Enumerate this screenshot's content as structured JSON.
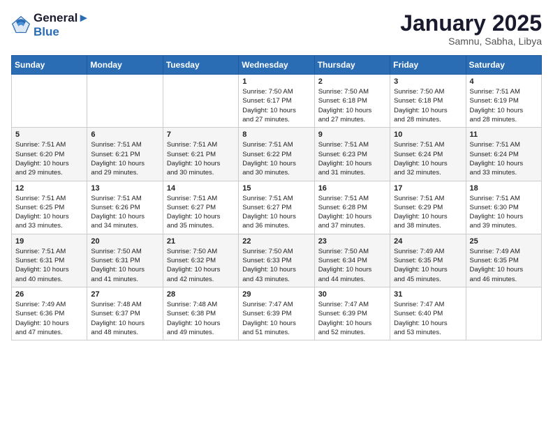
{
  "logo": {
    "line1": "General",
    "line2": "Blue"
  },
  "title": "January 2025",
  "subtitle": "Samnu, Sabha, Libya",
  "days_of_week": [
    "Sunday",
    "Monday",
    "Tuesday",
    "Wednesday",
    "Thursday",
    "Friday",
    "Saturday"
  ],
  "weeks": [
    [
      {
        "day": "",
        "content": ""
      },
      {
        "day": "",
        "content": ""
      },
      {
        "day": "",
        "content": ""
      },
      {
        "day": "1",
        "content": "Sunrise: 7:50 AM\nSunset: 6:17 PM\nDaylight: 10 hours\nand 27 minutes."
      },
      {
        "day": "2",
        "content": "Sunrise: 7:50 AM\nSunset: 6:18 PM\nDaylight: 10 hours\nand 27 minutes."
      },
      {
        "day": "3",
        "content": "Sunrise: 7:50 AM\nSunset: 6:18 PM\nDaylight: 10 hours\nand 28 minutes."
      },
      {
        "day": "4",
        "content": "Sunrise: 7:51 AM\nSunset: 6:19 PM\nDaylight: 10 hours\nand 28 minutes."
      }
    ],
    [
      {
        "day": "5",
        "content": "Sunrise: 7:51 AM\nSunset: 6:20 PM\nDaylight: 10 hours\nand 29 minutes."
      },
      {
        "day": "6",
        "content": "Sunrise: 7:51 AM\nSunset: 6:21 PM\nDaylight: 10 hours\nand 29 minutes."
      },
      {
        "day": "7",
        "content": "Sunrise: 7:51 AM\nSunset: 6:21 PM\nDaylight: 10 hours\nand 30 minutes."
      },
      {
        "day": "8",
        "content": "Sunrise: 7:51 AM\nSunset: 6:22 PM\nDaylight: 10 hours\nand 30 minutes."
      },
      {
        "day": "9",
        "content": "Sunrise: 7:51 AM\nSunset: 6:23 PM\nDaylight: 10 hours\nand 31 minutes."
      },
      {
        "day": "10",
        "content": "Sunrise: 7:51 AM\nSunset: 6:24 PM\nDaylight: 10 hours\nand 32 minutes."
      },
      {
        "day": "11",
        "content": "Sunrise: 7:51 AM\nSunset: 6:24 PM\nDaylight: 10 hours\nand 33 minutes."
      }
    ],
    [
      {
        "day": "12",
        "content": "Sunrise: 7:51 AM\nSunset: 6:25 PM\nDaylight: 10 hours\nand 33 minutes."
      },
      {
        "day": "13",
        "content": "Sunrise: 7:51 AM\nSunset: 6:26 PM\nDaylight: 10 hours\nand 34 minutes."
      },
      {
        "day": "14",
        "content": "Sunrise: 7:51 AM\nSunset: 6:27 PM\nDaylight: 10 hours\nand 35 minutes."
      },
      {
        "day": "15",
        "content": "Sunrise: 7:51 AM\nSunset: 6:27 PM\nDaylight: 10 hours\nand 36 minutes."
      },
      {
        "day": "16",
        "content": "Sunrise: 7:51 AM\nSunset: 6:28 PM\nDaylight: 10 hours\nand 37 minutes."
      },
      {
        "day": "17",
        "content": "Sunrise: 7:51 AM\nSunset: 6:29 PM\nDaylight: 10 hours\nand 38 minutes."
      },
      {
        "day": "18",
        "content": "Sunrise: 7:51 AM\nSunset: 6:30 PM\nDaylight: 10 hours\nand 39 minutes."
      }
    ],
    [
      {
        "day": "19",
        "content": "Sunrise: 7:51 AM\nSunset: 6:31 PM\nDaylight: 10 hours\nand 40 minutes."
      },
      {
        "day": "20",
        "content": "Sunrise: 7:50 AM\nSunset: 6:31 PM\nDaylight: 10 hours\nand 41 minutes."
      },
      {
        "day": "21",
        "content": "Sunrise: 7:50 AM\nSunset: 6:32 PM\nDaylight: 10 hours\nand 42 minutes."
      },
      {
        "day": "22",
        "content": "Sunrise: 7:50 AM\nSunset: 6:33 PM\nDaylight: 10 hours\nand 43 minutes."
      },
      {
        "day": "23",
        "content": "Sunrise: 7:50 AM\nSunset: 6:34 PM\nDaylight: 10 hours\nand 44 minutes."
      },
      {
        "day": "24",
        "content": "Sunrise: 7:49 AM\nSunset: 6:35 PM\nDaylight: 10 hours\nand 45 minutes."
      },
      {
        "day": "25",
        "content": "Sunrise: 7:49 AM\nSunset: 6:35 PM\nDaylight: 10 hours\nand 46 minutes."
      }
    ],
    [
      {
        "day": "26",
        "content": "Sunrise: 7:49 AM\nSunset: 6:36 PM\nDaylight: 10 hours\nand 47 minutes."
      },
      {
        "day": "27",
        "content": "Sunrise: 7:48 AM\nSunset: 6:37 PM\nDaylight: 10 hours\nand 48 minutes."
      },
      {
        "day": "28",
        "content": "Sunrise: 7:48 AM\nSunset: 6:38 PM\nDaylight: 10 hours\nand 49 minutes."
      },
      {
        "day": "29",
        "content": "Sunrise: 7:47 AM\nSunset: 6:39 PM\nDaylight: 10 hours\nand 51 minutes."
      },
      {
        "day": "30",
        "content": "Sunrise: 7:47 AM\nSunset: 6:39 PM\nDaylight: 10 hours\nand 52 minutes."
      },
      {
        "day": "31",
        "content": "Sunrise: 7:47 AM\nSunset: 6:40 PM\nDaylight: 10 hours\nand 53 minutes."
      },
      {
        "day": "",
        "content": ""
      }
    ]
  ]
}
